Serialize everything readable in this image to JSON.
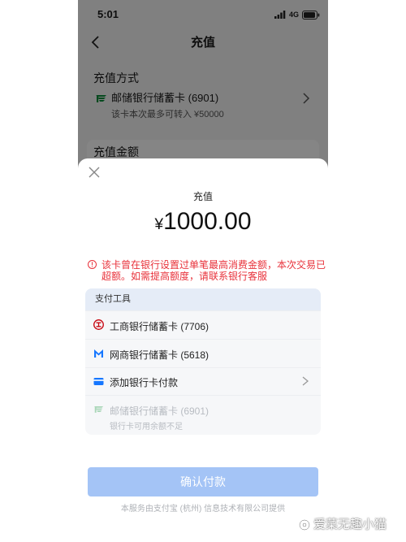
{
  "status_bar": {
    "time": "5:01",
    "network": "4G"
  },
  "nav": {
    "title": "充值"
  },
  "background_page": {
    "method_title": "充值方式",
    "method_bank": "邮储银行储蓄卡 (6901)",
    "method_limit": "该卡本次最多可转入 ¥50000",
    "amount_title": "充值金额"
  },
  "sheet": {
    "title": "充值",
    "currency": "¥",
    "amount": "1000.00",
    "warning_line1": "该卡曾在银行设置过单笔最高消费金额，本次交易已",
    "warning_line2": "超额。如需提高额度，请联系银行客服",
    "payment_tools": {
      "header": "支付工具",
      "options": [
        {
          "icon": "icbc-icon",
          "label": "工商银行储蓄卡 (7706)",
          "enabled": true
        },
        {
          "icon": "mybank-icon",
          "label": "网商银行储蓄卡 (5618)",
          "enabled": true
        },
        {
          "icon": "add-card-icon",
          "label": "添加银行卡付款",
          "enabled": true
        },
        {
          "icon": "postal-bank-icon",
          "label": "邮储银行储蓄卡 (6901)",
          "note": "银行卡可用余额不足",
          "enabled": false
        }
      ]
    },
    "confirm_label": "确认付款",
    "footer": "本服务由支付宝 (杭州) 信息技术有限公司提供"
  },
  "colors": {
    "warning": "#e8313a",
    "confirm_button": "#a4c4f6",
    "tools_header": "#e5ecf7",
    "accent": "#1677ff"
  },
  "watermark": "爱菜无趣小猫"
}
